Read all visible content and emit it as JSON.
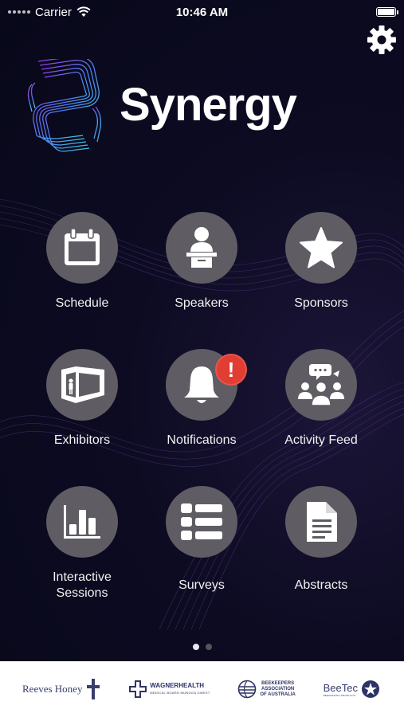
{
  "status_bar": {
    "carrier": "Carrier",
    "time": "10:46 AM",
    "battery_level": 1.0
  },
  "header": {
    "brand_name": "Synergy",
    "settings_icon": "gear-icon"
  },
  "tiles": [
    {
      "label": "Schedule",
      "icon": "calendar-icon"
    },
    {
      "label": "Speakers",
      "icon": "speaker-podium-icon"
    },
    {
      "label": "Sponsors",
      "icon": "star-icon"
    },
    {
      "label": "Exhibitors",
      "icon": "exhibition-booth-icon"
    },
    {
      "label": "Notifications",
      "icon": "bell-icon",
      "badge": "!"
    },
    {
      "label": "Activity Feed",
      "icon": "group-chat-icon"
    },
    {
      "label": "Interactive Sessions",
      "icon": "bar-chart-icon"
    },
    {
      "label": "Surveys",
      "icon": "list-icon"
    },
    {
      "label": "Abstracts",
      "icon": "document-icon"
    }
  ],
  "pager": {
    "pages": 2,
    "current": 1
  },
  "sponsors": {
    "reeves": "Reeves Honey",
    "wagner": "WAGNERHEALTH",
    "wagner_sub": "MEDICAL BOARD MUNGGA GWEST",
    "beekeepers": [
      "BEEKEEPERS",
      "ASSOCIATION",
      "OF AUSTRALIA"
    ],
    "beetec": "BeeTec",
    "beetec_sub": "BEEKEEPING PRODUCTS"
  },
  "colors": {
    "background": "#0b0a1e",
    "tile_circle": "#5f5d63",
    "badge": "#e23d33",
    "logo_gradient": [
      "#8f3bd9",
      "#3a8ff0",
      "#39d1e8"
    ]
  }
}
